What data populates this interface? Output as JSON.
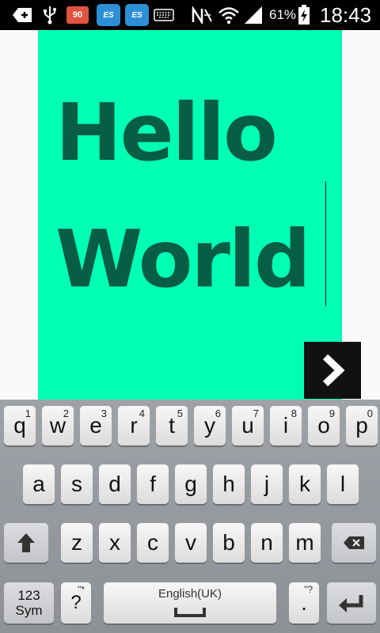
{
  "status_bar": {
    "notification_badge": "90",
    "es_icon_1": "ES",
    "es_icon_2": "ES",
    "battery_percent": "61%",
    "time": "18:43",
    "icons": [
      "add-icon",
      "usb-icon",
      "notification-badge",
      "es-file-explorer-icon",
      "es-file-explorer-icon",
      "keyboard-icon",
      "nfc-muted-icon",
      "wifi-icon",
      "signal-icon",
      "battery-charging-icon"
    ]
  },
  "content": {
    "background_color": "#00ffb4",
    "text_color": "#085d45",
    "line1": "Hello",
    "line2": "World",
    "next_button_icon": "chevron-right-icon"
  },
  "keyboard": {
    "row1": [
      {
        "key": "q",
        "num": "1"
      },
      {
        "key": "w",
        "num": "2"
      },
      {
        "key": "e",
        "num": "3"
      },
      {
        "key": "r",
        "num": "4"
      },
      {
        "key": "t",
        "num": "5"
      },
      {
        "key": "y",
        "num": "6"
      },
      {
        "key": "u",
        "num": "7"
      },
      {
        "key": "i",
        "num": "8"
      },
      {
        "key": "o",
        "num": "9"
      },
      {
        "key": "p",
        "num": "0"
      }
    ],
    "row2": [
      "a",
      "s",
      "d",
      "f",
      "g",
      "h",
      "j",
      "k",
      "l"
    ],
    "row3": [
      "z",
      "x",
      "c",
      "v",
      "b",
      "n",
      "m"
    ],
    "sym_label_line1": "123",
    "sym_label_line2": "Sym",
    "question_key": "?",
    "space_label": "English(UK)",
    "period_key": ".",
    "period_hint": "\"?",
    "question_hint": "\"*"
  }
}
